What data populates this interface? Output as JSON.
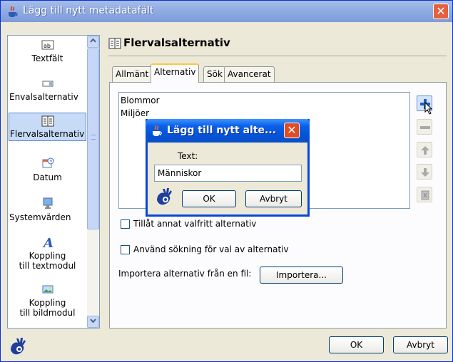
{
  "window": {
    "title": "Lägg till nytt metadatafält",
    "close_label": "✕"
  },
  "sidebar": {
    "items": [
      {
        "label": "Textfält",
        "icon": "text-field-icon"
      },
      {
        "label": "Envalsalternativ",
        "icon": "single-choice-icon"
      },
      {
        "label": "Flervalsalternativ",
        "icon": "multi-choice-icon"
      },
      {
        "label": "Datum",
        "icon": "calendar-icon"
      },
      {
        "label": "Systemvärden",
        "icon": "monitor-icon"
      },
      {
        "label": "Koppling",
        "label2": "till textmodul",
        "icon": "text-module-icon"
      },
      {
        "label": "Koppling",
        "label2": "till bildmodul",
        "icon": "image-module-icon"
      }
    ]
  },
  "header": {
    "title": "Flervalsalternativ"
  },
  "tabs": [
    {
      "label": "Allmänt"
    },
    {
      "label": "Alternativ"
    },
    {
      "label": "Sök"
    },
    {
      "label": "Avancerat"
    }
  ],
  "options": [
    "Blommor",
    "Miljöer"
  ],
  "checkboxes": {
    "allow_other": "Tillåt annat valfritt alternativ",
    "use_search": "Använd sökning för val av alternativ"
  },
  "import": {
    "label": "Importera alternativ från en fil:",
    "button": "Importera..."
  },
  "footer": {
    "ok": "OK",
    "cancel": "Avbryt"
  },
  "dialog": {
    "title": "Lägg till nytt alte...",
    "close_label": "✕",
    "text_label": "Text:",
    "text_value": "Människor",
    "ok": "OK",
    "cancel": "Avbryt"
  },
  "colors": {
    "accent": "#0846d8",
    "tab_highlight": "#ffc73c",
    "selection": "#c7dbf7"
  }
}
